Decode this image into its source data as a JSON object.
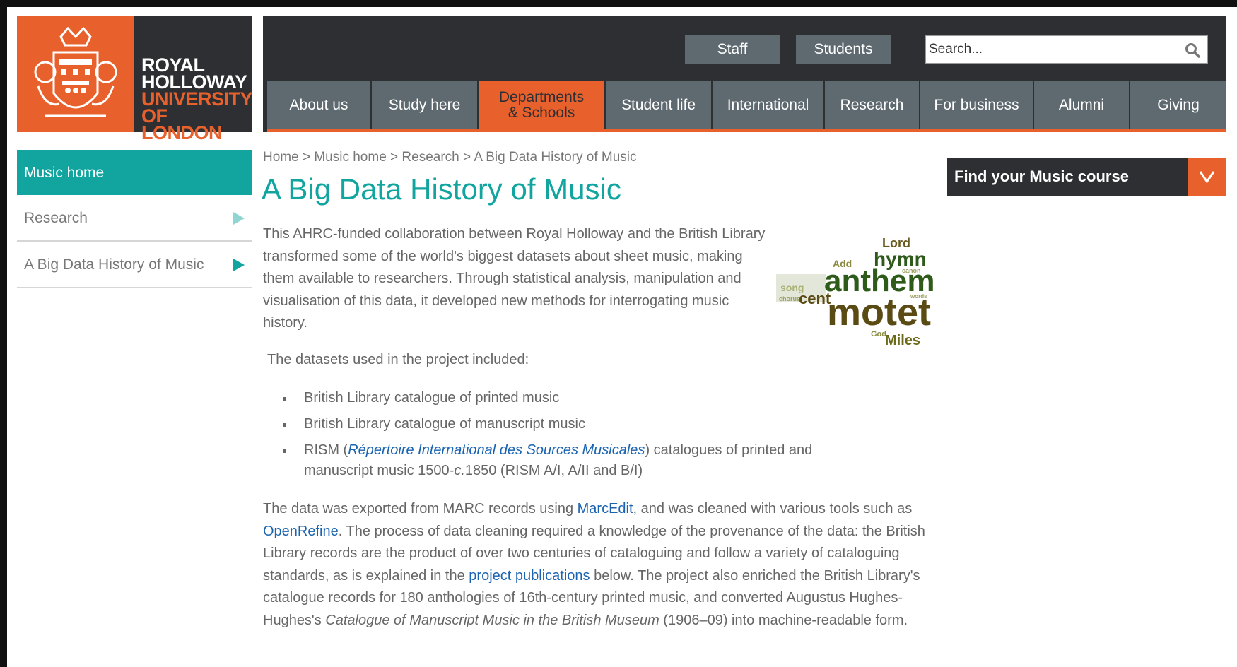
{
  "logo": {
    "line1": "ROYAL",
    "line2": "HOLLOWAY",
    "line3": "UNIVERSITY",
    "line4": "OF LONDON"
  },
  "utility": {
    "staff": "Staff",
    "students": "Students"
  },
  "search": {
    "placeholder": "Search..."
  },
  "nav": [
    {
      "label": "About us"
    },
    {
      "label": "Study here"
    },
    {
      "label": "Departments\n& Schools",
      "active": true
    },
    {
      "label": "Student life"
    },
    {
      "label": "International"
    },
    {
      "label": "Research"
    },
    {
      "label": "For business"
    },
    {
      "label": "Alumni"
    },
    {
      "label": "Giving"
    }
  ],
  "sidebar": {
    "home": "Music home",
    "items": [
      {
        "label": "Research"
      },
      {
        "label": "A Big Data History of Music"
      }
    ]
  },
  "breadcrumb": "Home > Music home > Research > A Big Data History of Music",
  "page_title": "A Big Data History of Music",
  "intro": "This AHRC-funded collaboration between Royal Holloway and the British Library transformed some of the world's biggest datasets about sheet music, making them available to researchers. Through statistical analysis, manipulation and visualisation of this data, it developed new methods for interrogating music history.",
  "datasets_intro": "The datasets used in the project included:",
  "datasets": {
    "item1": "British Library catalogue of printed music",
    "item2": "British Library catalogue of manuscript music",
    "item3_pre": "RISM (",
    "item3_link": "Répertoire International des Sources Musicales",
    "item3_mid": ") catalogues of printed and manuscript music 1500-",
    "item3_c": "c.",
    "item3_post": "1850 (RISM A/I, A/II and B/I)"
  },
  "para2": {
    "t1": "The data was exported from MARC records using ",
    "marcedit": "MarcEdit",
    "t2": ", and was cleaned with various tools such as ",
    "openrefine": "OpenRefine",
    "t3": ". The process of data cleaning required a knowledge of the provenance of the data: the British Library records are the product of over two centuries of cataloguing and follow a variety of cataloguing standards, as is explained in the ",
    "publications": "project publications",
    "t4": " below. The project also enriched the British Library's catalogue records for 180 anthologies of 16th-century printed music, and converted Augustus Hughes-Hughes's ",
    "catalogue": "Catalogue of Manuscript Music in the British Museum",
    "t5": " (1906–09) into machine-readable form."
  },
  "wordcloud": {
    "words": [
      "Lord",
      "hymn",
      "Add",
      "anthem",
      "song",
      "cent",
      "motet",
      "God",
      "Miles",
      "chorus",
      "canon",
      "words"
    ]
  },
  "course_finder": {
    "label": "Find your Music course"
  },
  "colors": {
    "accent": "#e8612c",
    "teal": "#12a5a0",
    "dark": "#2d2f33",
    "nav": "#5f6a70",
    "link": "#1a63b0"
  }
}
